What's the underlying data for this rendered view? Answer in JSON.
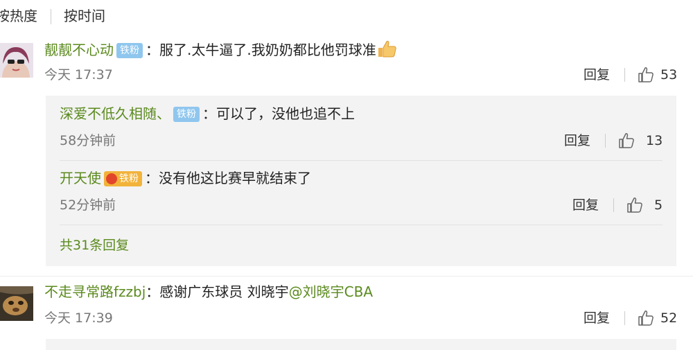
{
  "sort": {
    "hot": "按热度",
    "time": "按时间"
  },
  "comments": [
    {
      "user": "靓靓不心动",
      "badge": "铁粉",
      "text": "：服了.太牛逼了.我奶奶都比他罚球准",
      "emoji": "thumbs-up-emoji",
      "time": "今天 17:37",
      "reply_label": "回复",
      "likes": "53",
      "replies": [
        {
          "user": "深爱不低久相随、",
          "badge": "铁粉",
          "text": "：可以了，没他也追不上",
          "time": "58分钟前",
          "reply_label": "回复",
          "likes": "13"
        },
        {
          "user": "开天使",
          "badge": "铁粉",
          "text": "：没有他这比赛早就结束了",
          "time": "52分钟前",
          "reply_label": "回复",
          "likes": "5"
        }
      ],
      "more_replies": "共31条回复"
    },
    {
      "user": "不走寻常路fzzbj",
      "text": "：感谢广东球员 刘晓宇",
      "mention": "@刘晓宇CBA",
      "time": "今天 17:39",
      "reply_label": "回复",
      "likes": "52"
    }
  ],
  "colors": {
    "username": "#5b8a1e",
    "badge": "#8fc6ee",
    "badge_gold": "#f2b33b",
    "subbox": "#f3f3f3"
  }
}
